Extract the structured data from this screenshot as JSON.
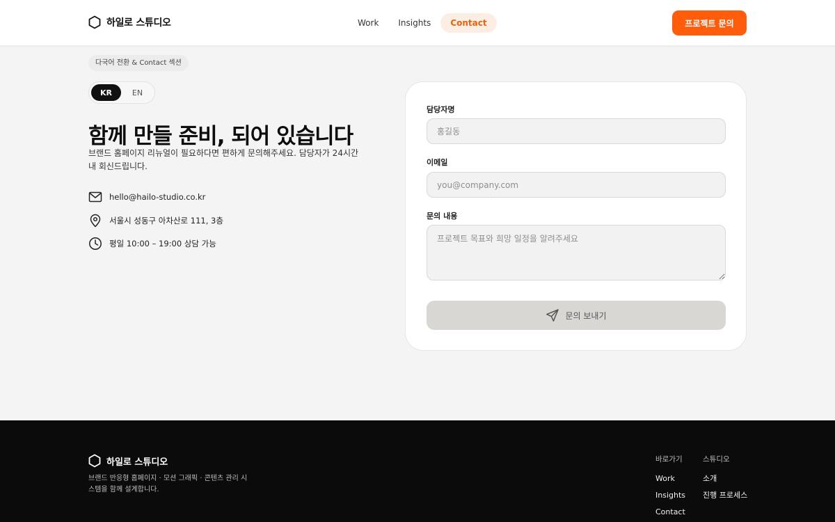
{
  "header": {
    "brand": "하일로 스튜디오",
    "nav": [
      {
        "label": "Work",
        "active": false
      },
      {
        "label": "Insights",
        "active": false
      },
      {
        "label": "Contact",
        "active": true
      }
    ],
    "cta": "프로젝트 문의"
  },
  "hero": {
    "section_tag": "다국어 전환 & Contact 섹션",
    "languages": [
      {
        "label": "KR",
        "active": true
      },
      {
        "label": "EN",
        "active": false
      }
    ],
    "title": "함께 만들 준비, 되어 있습니다",
    "subtitle": "브랜드 홈페이지 리뉴얼이 필요하다면 편하게 문의해주세요. 담당자가 24시간 내 회신드립니다.",
    "info": [
      {
        "icon": "mail-icon",
        "text": "hello@hailo-studio.co.kr"
      },
      {
        "icon": "map-pin-icon",
        "text": "서울시 성동구 아차산로 111, 3층"
      },
      {
        "icon": "clock-icon",
        "text": "평일 10:00 – 19:00 상담 가능"
      }
    ]
  },
  "form": {
    "name_label": "담당자명",
    "name_placeholder": "홍길동",
    "email_label": "이메일",
    "email_placeholder": "you@company.com",
    "message_label": "문의 내용",
    "message_placeholder": "프로젝트 목표와 희망 일정을 알려주세요",
    "submit_label": "문의 보내기"
  },
  "footer": {
    "brand": "하일로 스튜디오",
    "description": "브랜드 반응형 홈페이지 · 모션 그래픽 · 콘텐츠 관리 시스템을 함께 설계합니다.",
    "columns": [
      {
        "title": "바로가기",
        "links": [
          "Work",
          "Insights",
          "Contact"
        ]
      },
      {
        "title": "스튜디오",
        "links": [
          "소개",
          "진행 프로세스"
        ]
      }
    ]
  },
  "colors": {
    "accent": "#ff5d0c",
    "nav_active_bg": "#fdeee4",
    "footer_bg": "#0b0b0b"
  }
}
